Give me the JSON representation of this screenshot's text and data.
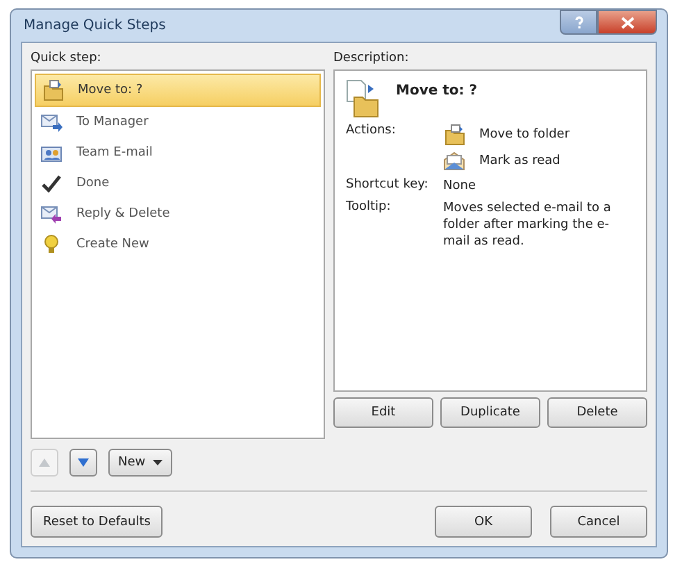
{
  "window": {
    "title": "Manage Quick Steps"
  },
  "quick_steps": {
    "label": "Quick step:",
    "items": [
      {
        "label": "Move to: ?",
        "kind": "move",
        "selected": true
      },
      {
        "label": "To Manager",
        "kind": "forward",
        "selected": false
      },
      {
        "label": "Team E-mail",
        "kind": "team",
        "selected": false
      },
      {
        "label": "Done",
        "kind": "check",
        "selected": false
      },
      {
        "label": "Reply & Delete",
        "kind": "reply",
        "selected": false
      },
      {
        "label": "Create New",
        "kind": "new",
        "selected": false
      }
    ]
  },
  "description": {
    "label": "Description:",
    "title": "Move to: ?",
    "actions_label": "Actions:",
    "actions": [
      {
        "label": "Move to folder",
        "kind": "move"
      },
      {
        "label": "Mark as read",
        "kind": "read"
      }
    ],
    "shortcut_label": "Shortcut key:",
    "shortcut": "None",
    "tooltip_label": "Tooltip:",
    "tooltip": "Moves selected e-mail to a folder after marking the e-mail as read."
  },
  "description_buttons": [
    "Edit",
    "Duplicate",
    "Delete"
  ],
  "move_buttons": [
    {
      "kind": "up",
      "disabled": true
    },
    {
      "kind": "down",
      "disabled": false
    }
  ],
  "new_button": "New",
  "reset_button": "Reset to Defaults",
  "buttons": [
    "OK",
    "Cancel"
  ]
}
